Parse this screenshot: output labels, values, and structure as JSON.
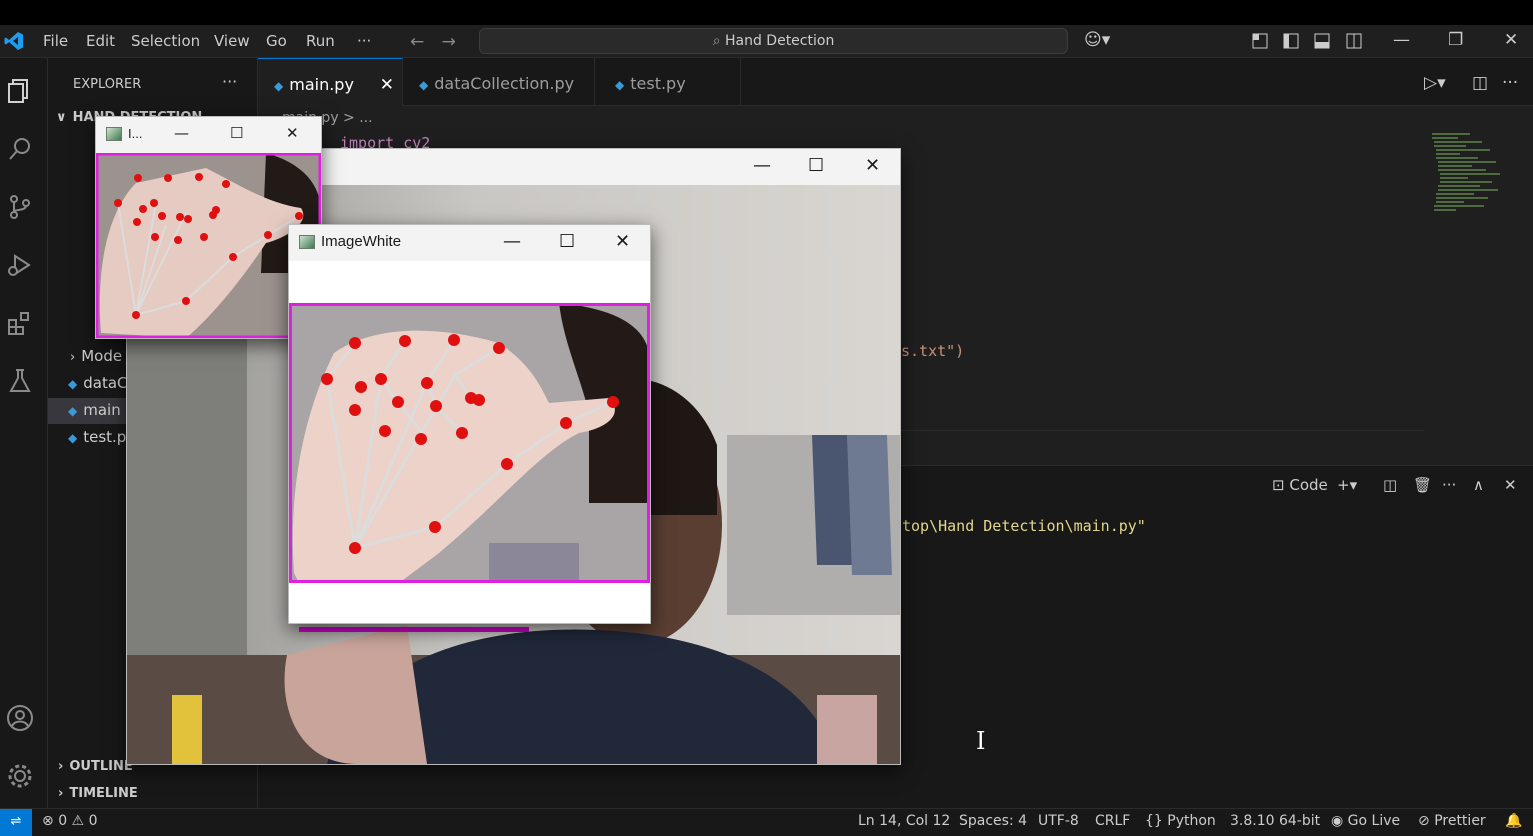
{
  "menu": [
    "File",
    "Edit",
    "Selection",
    "View",
    "Go",
    "Run",
    "···"
  ],
  "search": {
    "label": "Hand Detection"
  },
  "explorer": {
    "title": "EXPLORER",
    "more": "···",
    "folder": "HAND DETECTION",
    "items": [
      {
        "label": "Mode",
        "type": "folder"
      },
      {
        "label": "dataC",
        "type": "py"
      },
      {
        "label": "main",
        "type": "py",
        "selected": true
      },
      {
        "label": "test.p",
        "type": "py"
      }
    ],
    "outline": "OUTLINE",
    "timeline": "TIMELINE"
  },
  "tabs": [
    {
      "label": "main.py",
      "active": true,
      "close": "✕"
    },
    {
      "label": "dataCollection.py",
      "active": false
    },
    {
      "label": "test.py",
      "active": false
    }
  ],
  "breadcrumb": "main.py > ...",
  "code": {
    "line1": "import cv2",
    "fragment": "s.txt\")"
  },
  "terminal": {
    "profile": "Code",
    "line": "top\\Hand Detection\\main.py\""
  },
  "windows": {
    "small": {
      "title": "I..."
    },
    "main": {
      "title": ""
    },
    "white": {
      "title": "ImageWhite"
    }
  },
  "status": {
    "errors": "0",
    "warnings": "0",
    "position": "Ln 14, Col 12",
    "spaces": "Spaces: 4",
    "encoding": "UTF-8",
    "eol": "CRLF",
    "language": "Python",
    "interpreter": "3.8.10 64-bit",
    "golive": "Go Live",
    "prettier": "Prettier"
  },
  "colors": {
    "accent": "#0078d4",
    "bbox": "#e020e0",
    "landmark": "#e01010"
  }
}
